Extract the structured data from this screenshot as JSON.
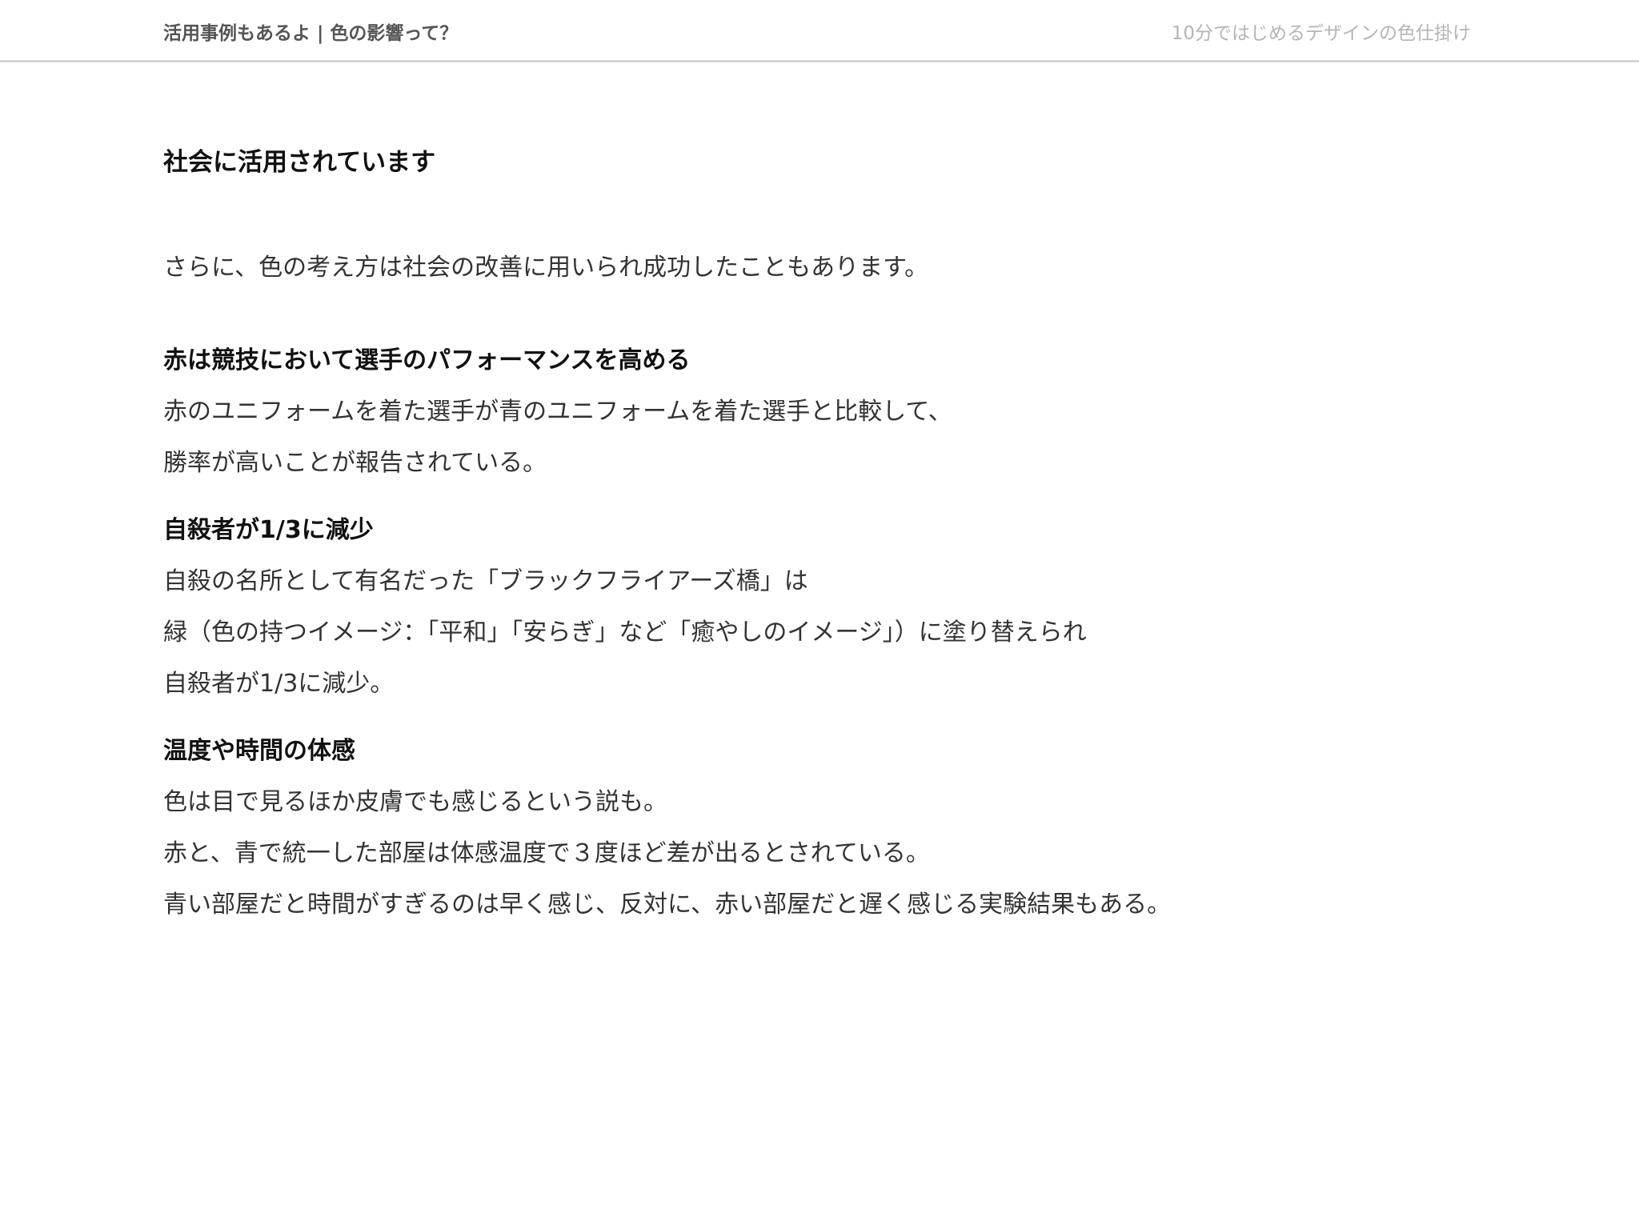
{
  "header": {
    "left_title": "活用事例もあるよ | 色の影響って？",
    "right_title": "10分ではじめるデザインの色仕掛け"
  },
  "main": {
    "title": "社会に活用されています",
    "intro": "さらに、色の考え方は社会の改善に用いられ成功したこともあります。",
    "sections": [
      {
        "heading": "赤は競技において選手のパフォーマンスを高める",
        "lines": [
          "赤のユニフォームを着た選手が青のユニフォームを着た選手と比較して、",
          "勝率が高いことが報告されている。"
        ]
      },
      {
        "heading": "自殺者が1/3に減少",
        "lines": [
          "自殺の名所として有名だった「ブラックフライアーズ橋」は",
          "緑（色の持つイメージ：「平和」「安らぎ」など「癒やしのイメージ」）に塗り替えられ",
          "自殺者が1/3に減少。"
        ]
      },
      {
        "heading": "温度や時間の体感",
        "lines": [
          "色は目で見るほか皮膚でも感じるという説も。",
          "赤と、青で統一した部屋は体感温度で３度ほど差が出るとされている。",
          "青い部屋だと時間がすぎるのは早く感じ、反対に、赤い部屋だと遅く感じる実験結果もある。"
        ]
      }
    ]
  }
}
